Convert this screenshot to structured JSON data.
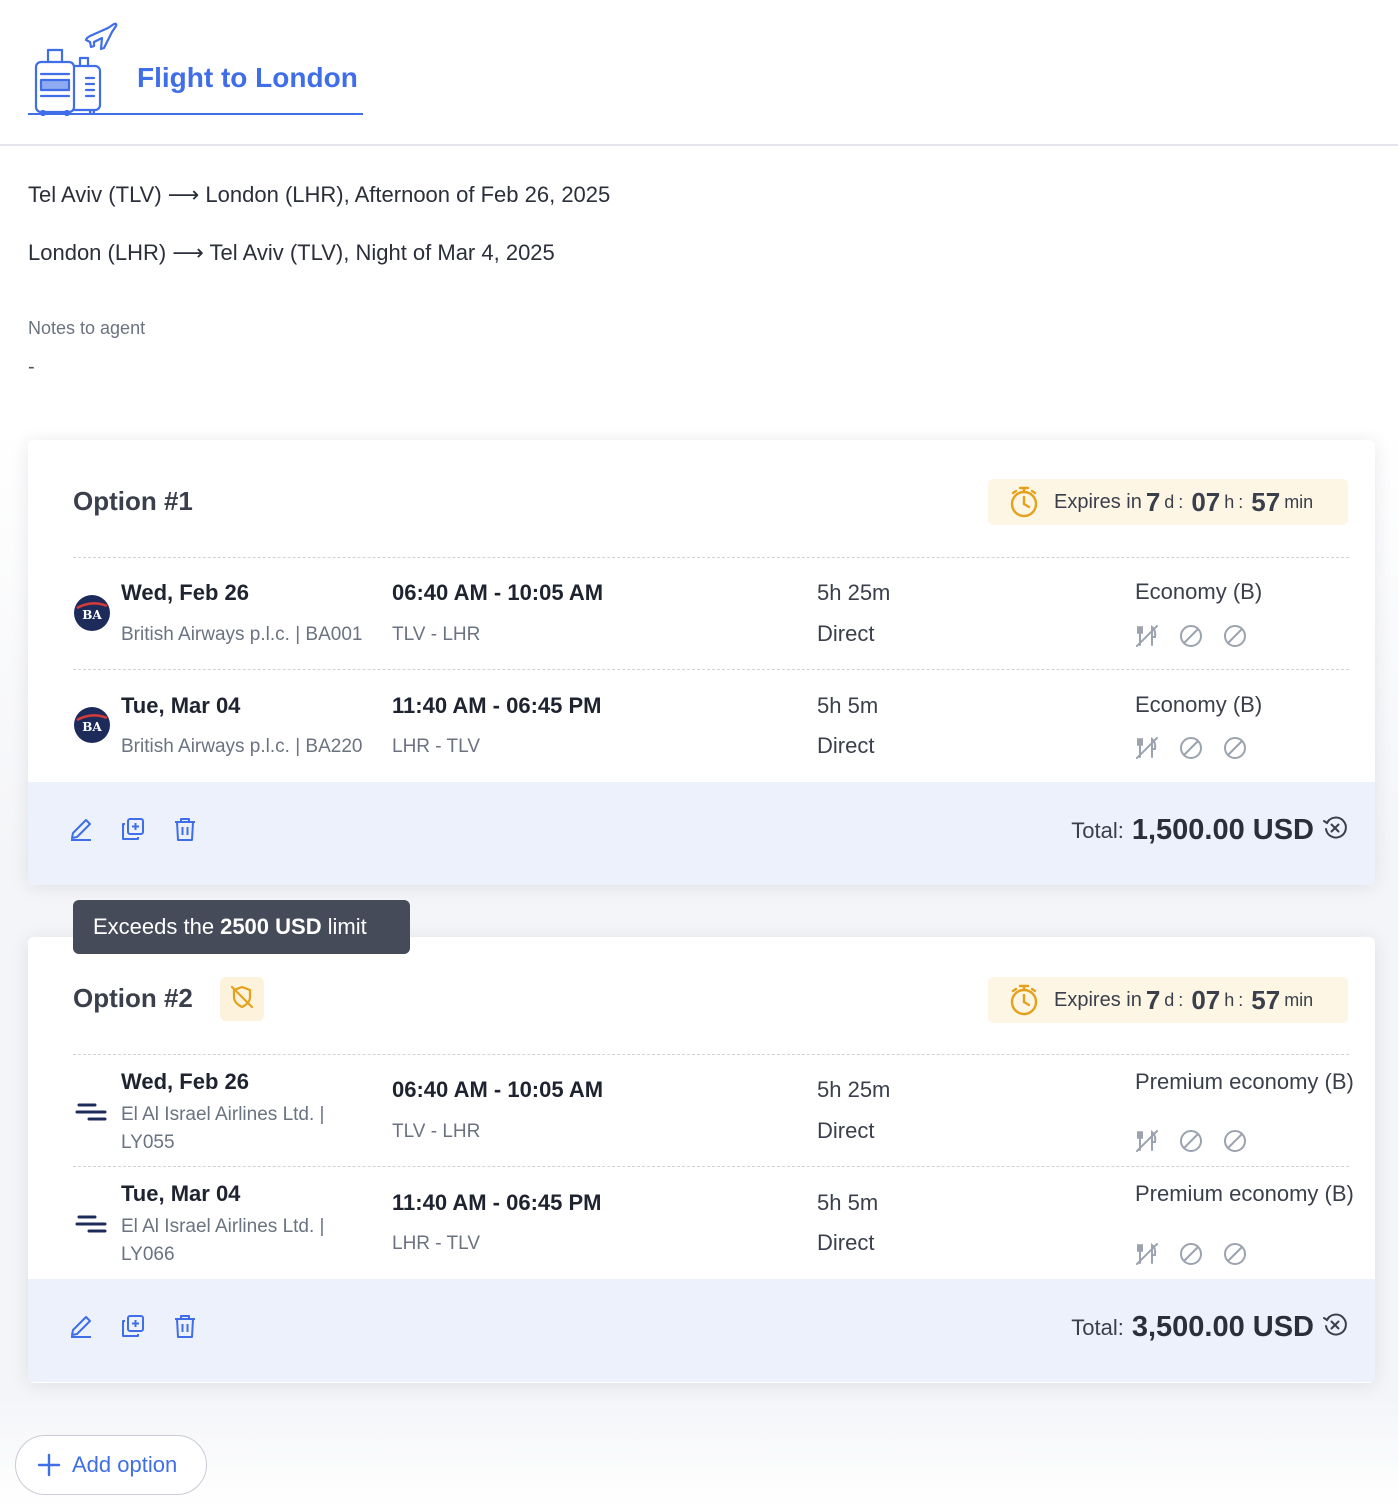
{
  "header": {
    "title": "Flight to London",
    "icon": "luggage-plane-icon"
  },
  "routes": [
    "Tel Aviv (TLV) ⟶ London (LHR), Afternoon of Feb 26, 2025",
    "London (LHR) ⟶ Tel Aviv (TLV), Night of Mar 4, 2025"
  ],
  "notes": {
    "label": "Notes to agent",
    "value": "-"
  },
  "options": [
    {
      "title": "Option #1",
      "expiry": {
        "prefix": "Expires in",
        "days": "7",
        "d": "d",
        "hours": "07",
        "h": "h",
        "minutes": "57",
        "min": "min",
        "sep": ":"
      },
      "legs": [
        {
          "date": "Wed, Feb 26",
          "carrier": "British Airways p.l.c. | BA001",
          "times": "06:40 AM - 10:05 AM",
          "route": "TLV - LHR",
          "duration": "5h 25m",
          "stops": "Direct",
          "cabin": "Economy (B)",
          "logo": "BA"
        },
        {
          "date": "Tue, Mar 04",
          "carrier": "British Airways p.l.c. | BA220",
          "times": "11:40 AM - 06:45 PM",
          "route": "LHR - TLV",
          "duration": "5h 5m",
          "stops": "Direct",
          "cabin": "Economy (B)",
          "logo": "BA"
        }
      ],
      "total": {
        "label": "Total:",
        "amount": "1,500.00 USD"
      }
    },
    {
      "title": "Option #2",
      "expiry": {
        "prefix": "Expires in",
        "days": "7",
        "d": "d",
        "hours": "07",
        "h": "h",
        "minutes": "57",
        "min": "min",
        "sep": ":"
      },
      "legs": [
        {
          "date": "Wed, Feb 26",
          "carrier_line1": "El Al Israel Airlines Ltd. |",
          "carrier_line2": "LY055",
          "times": "06:40 AM - 10:05 AM",
          "route": "TLV - LHR",
          "duration": "5h 25m",
          "stops": "Direct",
          "cabin": "Premium economy (B)"
        },
        {
          "date": "Tue, Mar 04",
          "carrier_line1": "El Al Israel Airlines Ltd. |",
          "carrier_line2": "LY066",
          "times": "11:40 AM - 06:45 PM",
          "route": "LHR - TLV",
          "duration": "5h 5m",
          "stops": "Direct",
          "cabin": "Premium economy (B)"
        }
      ],
      "total": {
        "label": "Total:",
        "amount": "3,500.00 USD"
      }
    }
  ],
  "tooltip": {
    "pre": "Exceeds the",
    "bold": "2500 USD",
    "post": "limit"
  },
  "add_option": {
    "label": "Add option"
  },
  "colors": {
    "accent": "#3f6ee8",
    "warning": "#e5a11b",
    "footer_bg": "#edf1fc",
    "expiry_bg": "#fdf6e5"
  }
}
